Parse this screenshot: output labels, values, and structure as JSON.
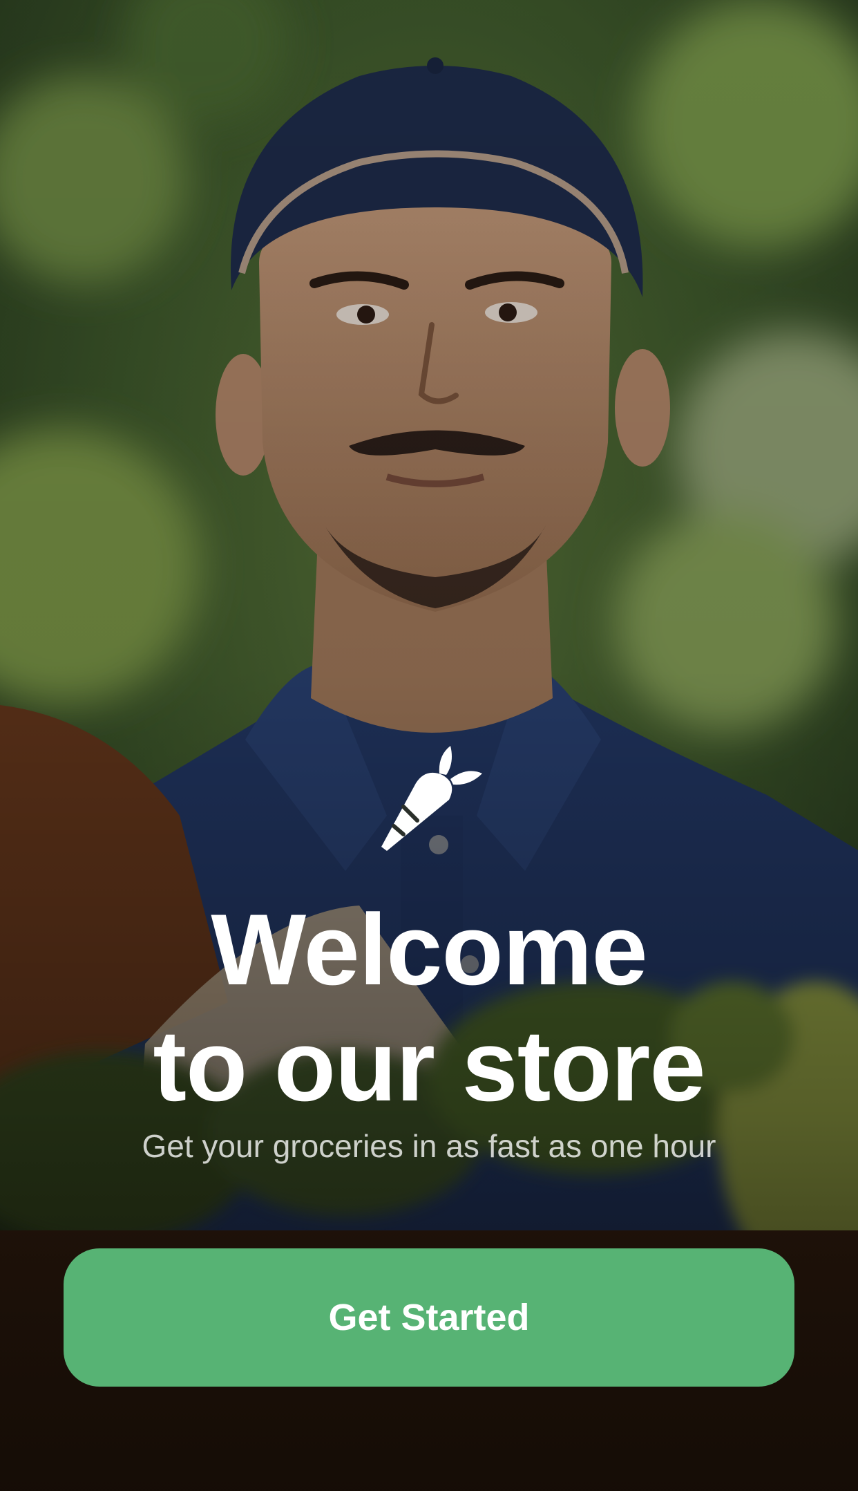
{
  "welcome": {
    "title_line1": "Welcome",
    "title_line2": "to our store",
    "subtitle": "Get your groceries in as fast as one hour"
  },
  "actions": {
    "get_started_label": "Get Started"
  },
  "brand": {
    "logo_icon": "carrot-icon"
  },
  "colors": {
    "accent": "#57b374",
    "text": "#ffffff"
  }
}
